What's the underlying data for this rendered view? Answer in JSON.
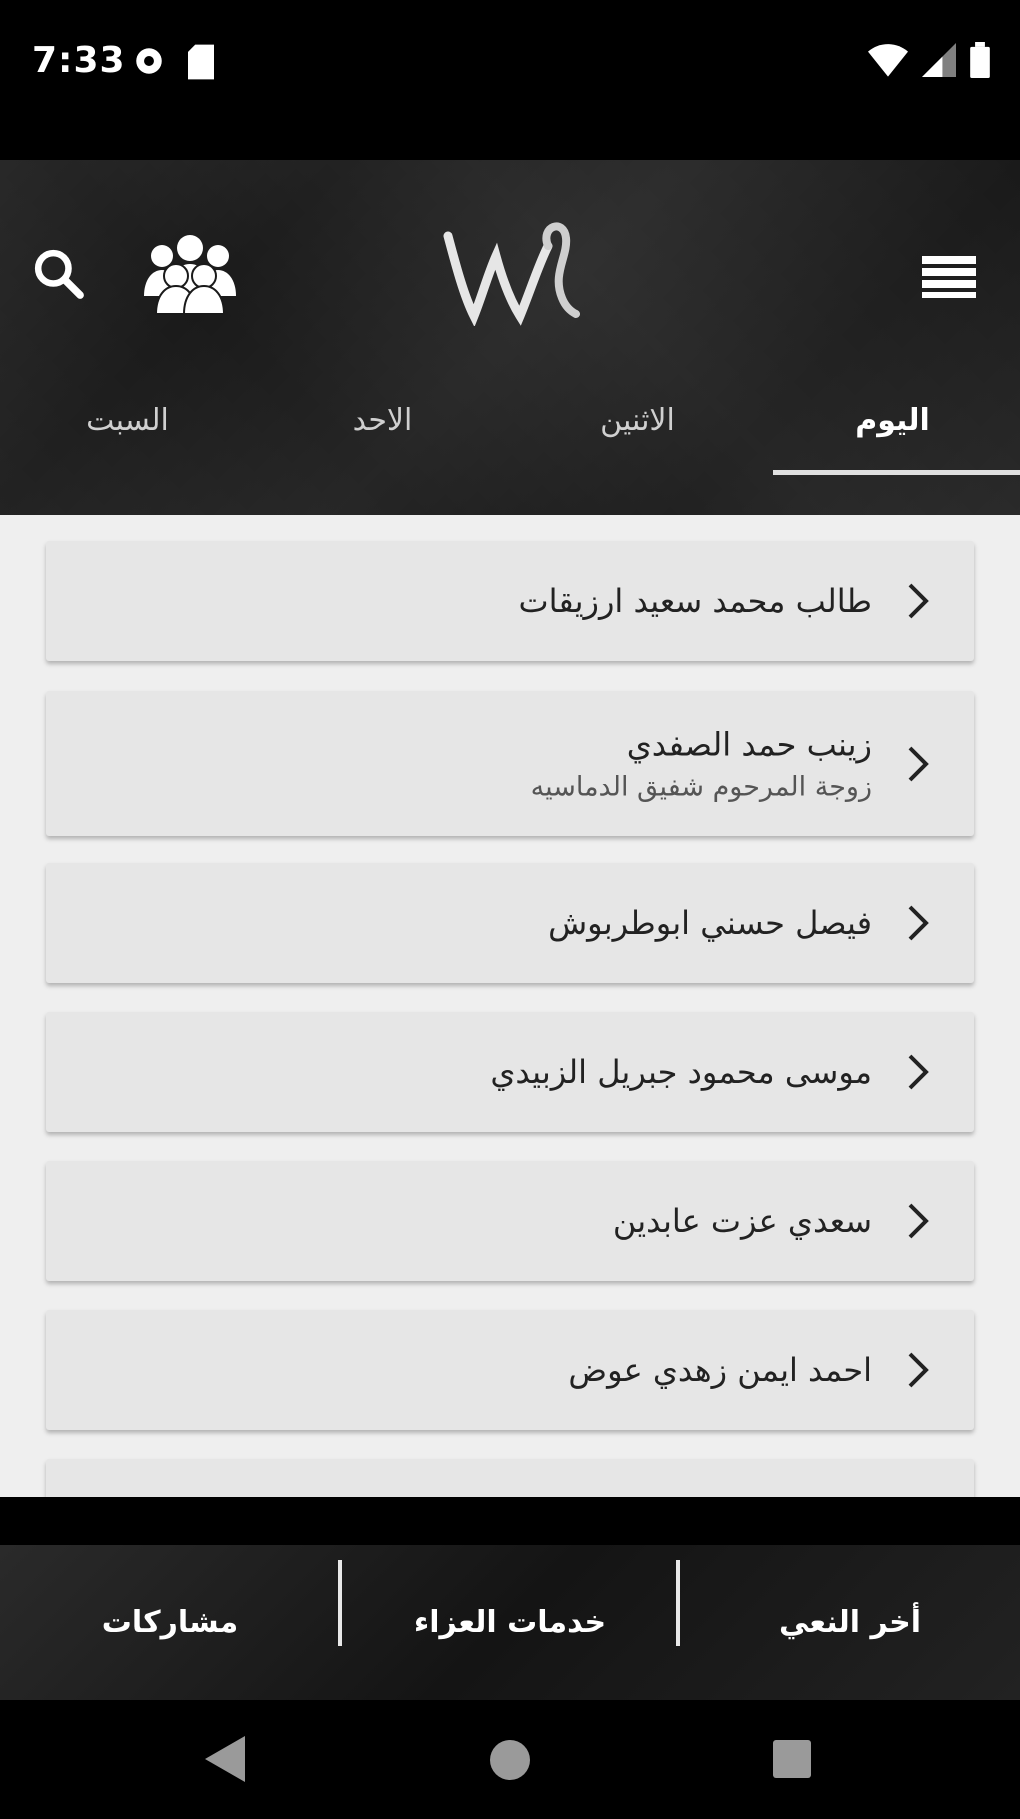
{
  "status_bar": {
    "time": "7:33"
  },
  "header": {
    "tabs": [
      {
        "label": "اليوم",
        "active": true
      },
      {
        "label": "الاثنين",
        "active": false
      },
      {
        "label": "الاحد",
        "active": false
      },
      {
        "label": "السبت",
        "active": false
      }
    ]
  },
  "list": [
    {
      "title": "طالب محمد سعيد ارزيقات",
      "subtitle": ""
    },
    {
      "title": "زينب حمد الصفدي",
      "subtitle": "زوجة المرحوم شفيق الدماسيه"
    },
    {
      "title": "فيصل حسني ابوطربوش",
      "subtitle": ""
    },
    {
      "title": "موسى محمود جبريل الزبيدي",
      "subtitle": ""
    },
    {
      "title": "سعدي عزت عابدين",
      "subtitle": ""
    },
    {
      "title": "احمد ايمن زهدي عوض",
      "subtitle": ""
    }
  ],
  "bottom_bar": {
    "items": [
      "أخر النعي",
      "خدمات العزاء",
      "مشاركات"
    ]
  },
  "colors": {
    "header_bg": "#1a1a1a",
    "list_bg": "#efefef",
    "card_bg": "#e6e6e6",
    "tab_indicator": "#e0e0e0"
  }
}
